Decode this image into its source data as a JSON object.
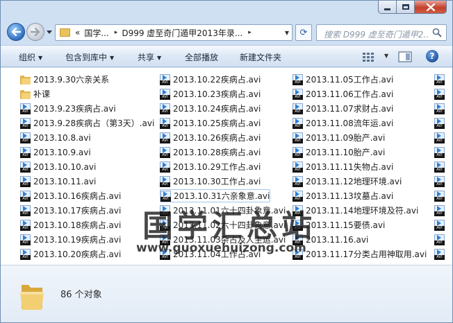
{
  "window": {
    "title_buttons": {
      "minimize": "minimize-icon",
      "maximize": "maximize-icon",
      "close": "close-icon"
    }
  },
  "nav": {
    "address": {
      "overflow": "«",
      "crumbs": [
        "国学...",
        "D999 虚至奇门遁甲2013年录..."
      ],
      "separator": "▸"
    },
    "search_placeholder": "搜索 D999 虚至奇门遁甲2..."
  },
  "toolbar": {
    "organize": "组织",
    "include_in_library": "包含到库中",
    "share": "共享",
    "play_all": "全部播放",
    "new_folder": "新建文件夹",
    "help": "?"
  },
  "files": {
    "column1": [
      {
        "name": "2013.9.30六亲关系",
        "type": "folder"
      },
      {
        "name": "补课",
        "type": "folder"
      },
      {
        "name": "2013.9.23疾病占.avi",
        "type": "avi"
      },
      {
        "name": "2013.9.28疾病占（第3天）.avi",
        "type": "avi"
      },
      {
        "name": "2013.10.8.avi",
        "type": "avi"
      },
      {
        "name": "2013.10.9.avi",
        "type": "avi"
      },
      {
        "name": "2013.10.10.avi",
        "type": "avi"
      },
      {
        "name": "2013.10.11.avi",
        "type": "avi"
      },
      {
        "name": "2013.10.16疾病占.avi",
        "type": "avi"
      },
      {
        "name": "2013.10.17疾病占.avi",
        "type": "avi"
      },
      {
        "name": "2013.10.18疾病占.avi",
        "type": "avi"
      },
      {
        "name": "2013.10.19疾病占.avi",
        "type": "avi"
      },
      {
        "name": "2013.10.20疾病占.avi",
        "type": "avi"
      }
    ],
    "column2": [
      {
        "name": "2013.10.22疾病占.avi",
        "type": "avi"
      },
      {
        "name": "2013.10.23疾病占.avi",
        "type": "avi"
      },
      {
        "name": "2013.10.24疾病占.avi",
        "type": "avi"
      },
      {
        "name": "2013.10.25疾病占.avi",
        "type": "avi"
      },
      {
        "name": "2013.10.26疾病占.avi",
        "type": "avi"
      },
      {
        "name": "2013.10.28疾病占.avi",
        "type": "avi"
      },
      {
        "name": "2013.10.29工作占.avi",
        "type": "avi"
      },
      {
        "name": "2013.10.30工作占.avi",
        "type": "avi"
      },
      {
        "name": "2013.10.31六亲象意.avi",
        "type": "avi",
        "selected": true
      },
      {
        "name": "2013.11.01六十四卦象意.avi",
        "type": "avi"
      },
      {
        "name": "2013.11.02六十四卦象意.avi",
        "type": "avi"
      },
      {
        "name": "2013.11.03杂占及人生运.avi",
        "type": "avi"
      },
      {
        "name": "2013.11.04工作占.avi",
        "type": "avi"
      }
    ],
    "column3": [
      {
        "name": "2013.11.05工作占.avi",
        "type": "avi"
      },
      {
        "name": "2013.11.06工作占.avi",
        "type": "avi"
      },
      {
        "name": "2013.11.07求财占.avi",
        "type": "avi"
      },
      {
        "name": "2013.11.08流年运.avi",
        "type": "avi"
      },
      {
        "name": "2013.11.09胎产.avi",
        "type": "avi"
      },
      {
        "name": "2013.11.10胎产.avi",
        "type": "avi"
      },
      {
        "name": "2013.11.11失物占.avi",
        "type": "avi"
      },
      {
        "name": "2013.11.12地理环境.avi",
        "type": "avi"
      },
      {
        "name": "2013.11.13坟墓占.avi",
        "type": "avi"
      },
      {
        "name": "2013.11.14地理环境及符.avi",
        "type": "avi"
      },
      {
        "name": "2013.11.15要债.avi",
        "type": "avi"
      },
      {
        "name": "2013.11.16.avi",
        "type": "avi"
      },
      {
        "name": "2013.11.17分类占用神取用.avi",
        "type": "avi"
      }
    ],
    "column4_icons": 13
  },
  "icon_tag": "AVI",
  "watermark": {
    "title": "国学汇总站",
    "url": "www.guoxuehuizong.com"
  },
  "details": {
    "item_count": "86 个对象"
  }
}
